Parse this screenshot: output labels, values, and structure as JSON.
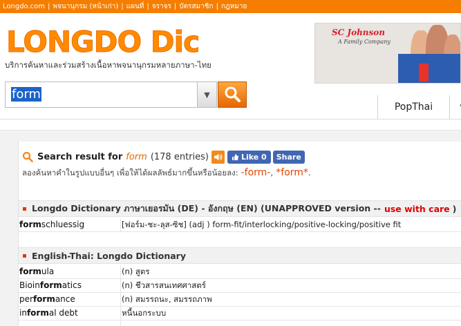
{
  "topnav": {
    "items": [
      "Longdo.com",
      "พจนานุกรม (หน้าเก่า)",
      "แผนที่",
      "จราจร",
      "บัตรสมาชิก",
      "กฎหมาย"
    ]
  },
  "logo": {
    "text": "LONGDO Dict",
    "tagline": "บริการค้นหาและร่วมสร้างเนื้อหาพจนานุกรมหลายภาษา-ไทย"
  },
  "ad": {
    "brand": "SC Johnson",
    "slogan": "A Family Company"
  },
  "search": {
    "value": "form",
    "dropdown_icon": "triangle-down",
    "button_icon": "magnifier"
  },
  "tabs": [
    "PopThai",
    "ป"
  ],
  "result": {
    "label": "Search result for",
    "query": "form",
    "count": "(178 entries)",
    "like_label": "Like 0",
    "share_label": "Share",
    "suggest_text": "ลองค้นหาคำในรูปแบบอื่นๆ เพื่อให้ได้ผลลัพธ์มากขึ้นหรือน้อยลง:",
    "suggest_alt1": "-form-",
    "suggest_alt2": "*form*",
    "suggest_sep": ",",
    "suggest_end": "."
  },
  "sections": [
    {
      "title": "Longdo Dictionary ภาษาเยอรมัน (DE) - อังกฤษ (EN) (UNAPPROVED version --",
      "warning": "use with care",
      "warning_end": ")",
      "rows": [
        {
          "pre": "",
          "hit": "form",
          "post": "schluessig",
          "def": "[ฟอร์ม-ชะ-ลุส-ซิช] (adj ) form-fit/interlocking/positive-locking/positive fit"
        }
      ]
    },
    {
      "title": "English-Thai: Longdo Dictionary",
      "rows": [
        {
          "pre": "",
          "hit": "form",
          "post": "ula",
          "def": "(n) สูตร"
        },
        {
          "pre": "Bioin",
          "hit": "form",
          "post": "atics",
          "def": "(n) ชีวสารสนเทศศาสตร์"
        },
        {
          "pre": "per",
          "hit": "form",
          "post": "ance",
          "def": "(n) สมรรถนะ, สมรรถภาพ"
        },
        {
          "pre": "in",
          "hit": "form",
          "post": "al debt",
          "def": "หนี้นอกระบบ"
        }
      ]
    }
  ],
  "colors": {
    "orange": "#f57e00",
    "search_highlight": "#1b63c8",
    "warning": "#e00000",
    "fb": "#4267b2"
  }
}
